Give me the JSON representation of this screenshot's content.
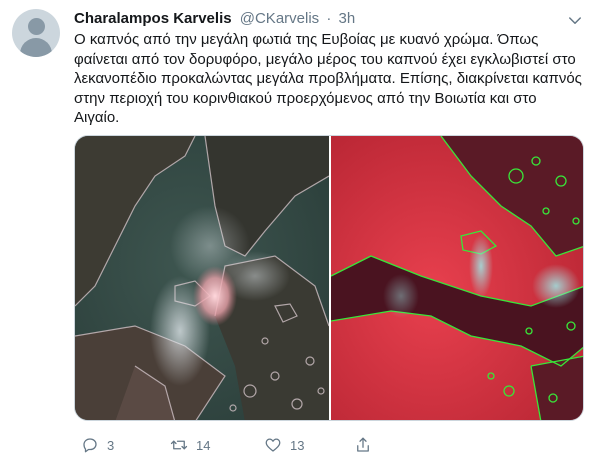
{
  "author": {
    "name": "Charalampos Karvelis",
    "handle": "@CKarvelis",
    "separator": "·",
    "time": "3h"
  },
  "tweet": {
    "text": "Ο καπνός από την μεγάλη φωτιά της Ευβοίας με κυανό χρώμα. Όπως φαίνεται από τον δορυφόρο, μεγάλο μέρος του καπνού έχει εγκλωβιστεί στο λεκανοπέδιο προκαλώντας μεγάλα προβλήματα. Επίσης, διακρίνεται καπνός στην περιοχή του κορινθιακού προερχόμενος από την Βοιωτία και στο Αιγαίο."
  },
  "media": {
    "images": [
      "satellite-natural-color",
      "satellite-false-color"
    ]
  },
  "actions": {
    "reply": {
      "icon": "reply-icon",
      "count": "3"
    },
    "retweet": {
      "icon": "retweet-icon",
      "count": "14"
    },
    "like": {
      "icon": "heart-icon",
      "count": "13"
    },
    "share": {
      "icon": "share-icon"
    }
  },
  "colors": {
    "name": "#14171a",
    "secondary": "#657786",
    "coastline_left": "#c7b9bd",
    "coastline_right": "#39e639",
    "false_color_land": "#d9303e"
  }
}
